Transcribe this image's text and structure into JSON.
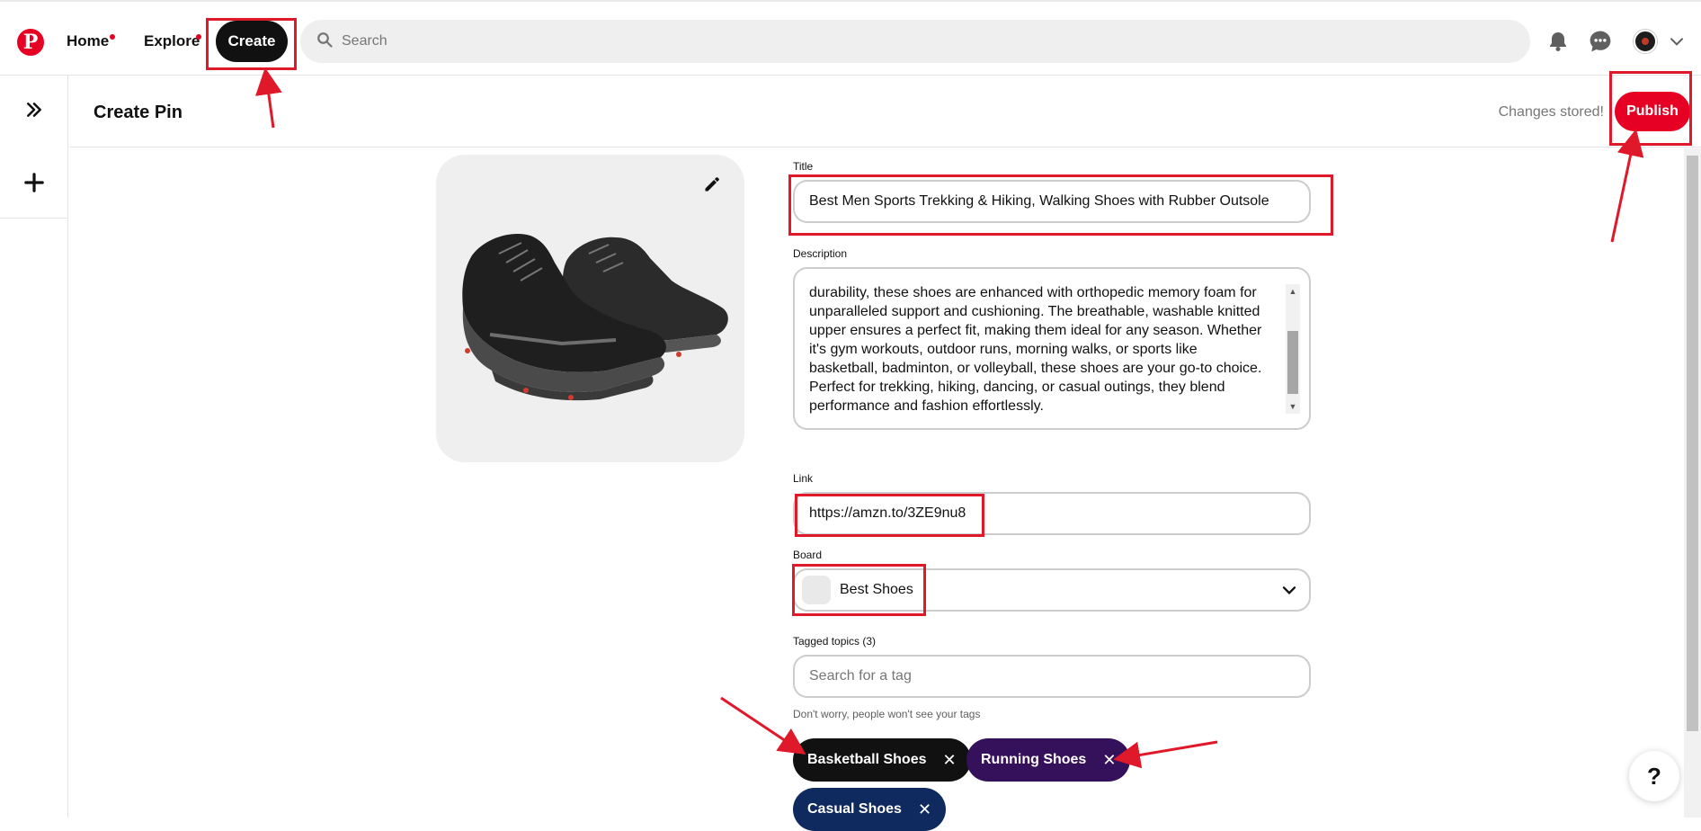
{
  "nav": {
    "home_label": "Home",
    "explore_label": "Explore",
    "create_label": "Create",
    "search_placeholder": "Search"
  },
  "header": {
    "title": "Create Pin",
    "status": "Changes stored!",
    "publish_label": "Publish"
  },
  "form": {
    "title_label": "Title",
    "title_value": "Best Men Sports Trekking & Hiking, Walking Shoes with Rubber Outsole",
    "description_label": "Description",
    "description_value": "durability, these shoes are enhanced with orthopedic memory foam for unparalleled support and cushioning. The breathable, washable knitted upper ensures a perfect fit, making them ideal for any season. Whether it's gym workouts, outdoor runs, morning walks, or sports like basketball, badminton, or volleyball, these shoes are your go-to choice. Perfect for trekking, hiking, dancing, or casual outings, they blend performance and fashion effortlessly.",
    "link_label": "Link",
    "link_value": "https://amzn.to/3ZE9nu8",
    "board_label": "Board",
    "board_value": "Best Shoes",
    "tags_label": "Tagged topics (3)",
    "tags_placeholder": "Search for a tag",
    "tags_hint": "Don't worry, people won't see your tags",
    "tags": [
      {
        "label": "Basketball Shoes",
        "color": "#111111"
      },
      {
        "label": "Running Shoes",
        "color": "#35105b"
      },
      {
        "label": "Casual Shoes",
        "color": "#0f2a5e"
      }
    ]
  },
  "help_label": "?",
  "colors": {
    "brand": "#e60023",
    "annotation": "#e0192a"
  },
  "icons": {
    "logo": "pinterest-logo-icon",
    "search": "search-icon",
    "notifications": "bell-icon",
    "messages": "chat-icon",
    "account_menu": "chevron-down-icon",
    "expand_sidebar": "double-chevron-right-icon",
    "create_new": "plus-icon",
    "edit_image": "pencil-icon",
    "board_dropdown": "chevron-down-icon",
    "remove_tag": "close-icon"
  }
}
